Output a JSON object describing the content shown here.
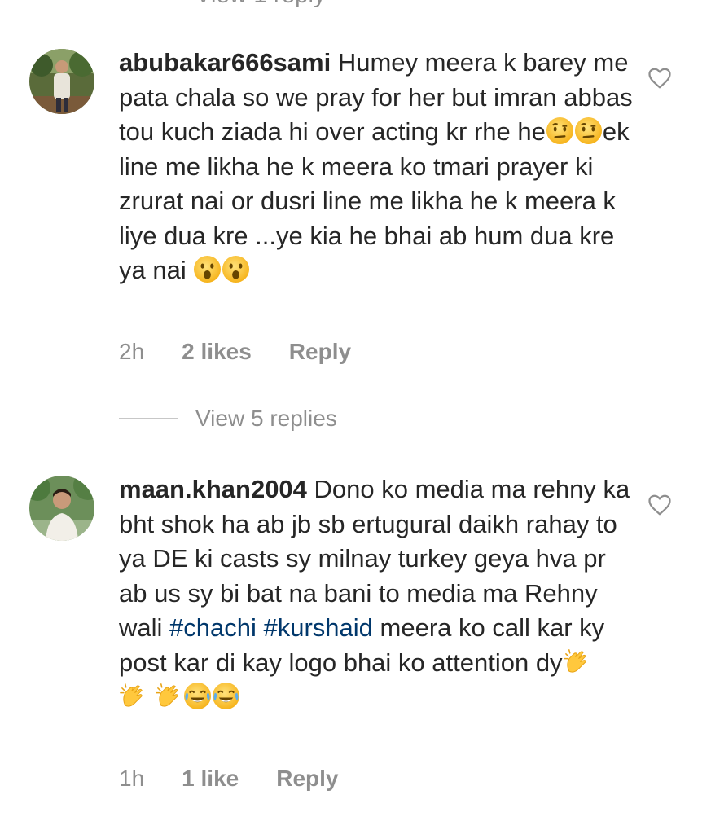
{
  "top_partial": "View 1 reply",
  "comments": [
    {
      "username": "abubakar666sami",
      "text_1": " Humey meera k barey me pata chala so we pray for her but imran abbas tou  kuch ziada hi over acting kr rhe he",
      "text_2": "ek line me likha he k meera ko tmari prayer ki zrurat nai or dusri line me likha he k meera k liye dua kre ...ye kia he bhai ab hum dua kre ya nai ",
      "time": "2h",
      "likes": "2 likes",
      "reply": "Reply",
      "view_replies": "View 5 replies"
    },
    {
      "username": "maan.khan2004",
      "text_1": " Dono ko media ma rehny ka bht shok ha ab jb sb ertugural daikh rahay to ya DE ki casts sy milnay turkey geya hva pr ab us sy bi bat na bani to media ma Rehny wali ",
      "hashtag_1": "#chachi",
      "hashtag_2": "#kurshaid",
      "text_2": " meera ko call kar ky post kar di kay logo bhai ko attention dy",
      "time": "1h",
      "likes": "1 like",
      "reply": "Reply"
    }
  ],
  "icons": {
    "heart": "heart-outline-icon",
    "raised_eyebrow": "face-with-raised-eyebrow-icon",
    "hushed": "hushed-face-icon",
    "clapping": "clapping-hands-icon",
    "laughing": "face-with-tears-of-joy-icon"
  },
  "colors": {
    "text": "#262626",
    "secondary": "#8e8e8e",
    "hashtag": "#00376b",
    "emoji_yellow": "#ffc83d"
  }
}
